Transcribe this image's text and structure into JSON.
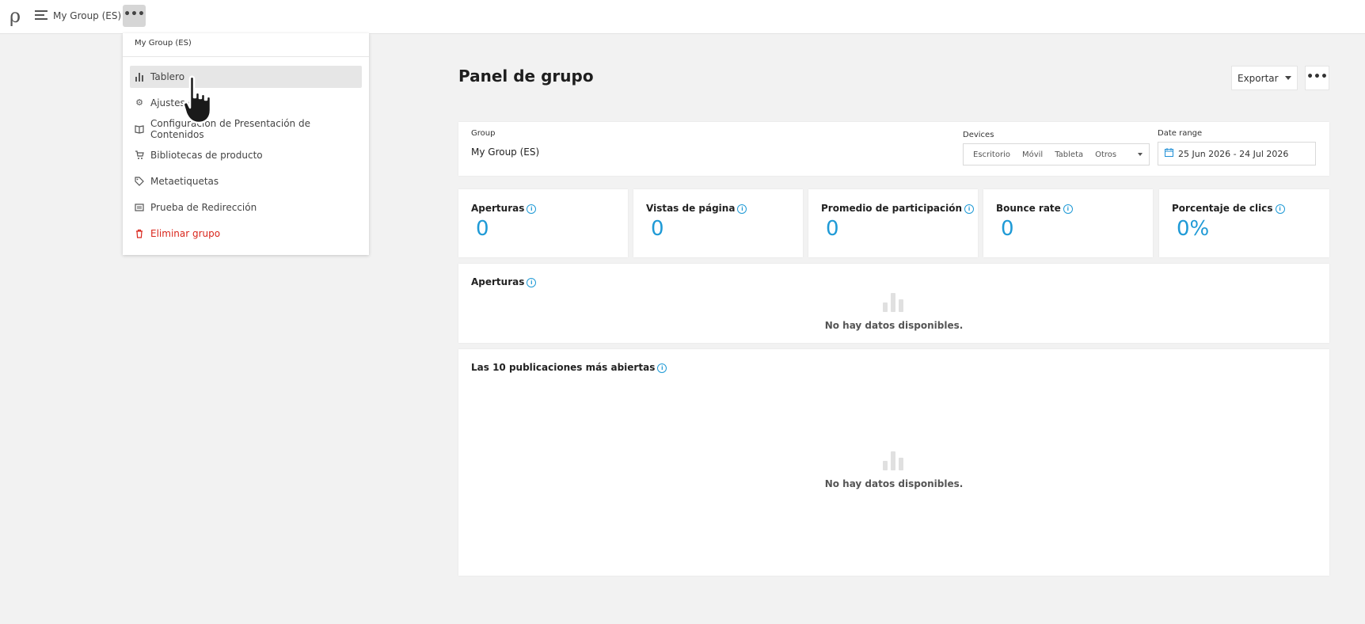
{
  "topbar": {
    "logo": "ρ",
    "title": "My Group (ES)",
    "more_glyph": "•••"
  },
  "dropdown": {
    "header": "My Group (ES)",
    "items": [
      {
        "label": "Tablero",
        "icon": "bar-chart-icon",
        "glyph": "▮"
      },
      {
        "label": "Ajustes d",
        "icon": "gear-icon",
        "glyph": "⚙"
      },
      {
        "label": "Configuración de Presentación de Contenidos",
        "icon": "book-icon",
        "glyph": "❐"
      },
      {
        "label": "Bibliotecas de producto",
        "icon": "cart-icon",
        "glyph": "⛟"
      },
      {
        "label": "Metaetiquetas",
        "icon": "tag-icon",
        "glyph": "⌂"
      },
      {
        "label": "Prueba de Redirección",
        "icon": "redirect-icon",
        "glyph": "▣"
      },
      {
        "label": "Eliminar grupo",
        "icon": "trash-icon",
        "glyph": "🗑"
      }
    ]
  },
  "main": {
    "title": "Panel de grupo",
    "export_label": "Exportar",
    "kebab_glyph": "•••"
  },
  "filters": {
    "group_label": "Group",
    "group_value": "My Group (ES)",
    "devices_label": "Devices",
    "devices": [
      "Escritorio",
      "Móvil",
      "Tableta",
      "Otros"
    ],
    "date_label": "Date range",
    "date_value": "25 Jun 2026 - 24 Jul 2026"
  },
  "metrics": [
    {
      "label": "Aperturas",
      "value": "0"
    },
    {
      "label": "Vistas de página",
      "value": "0"
    },
    {
      "label": "Promedio de participación",
      "value": "0"
    },
    {
      "label": "Bounce rate",
      "value": "0"
    },
    {
      "label": "Porcentaje de clics",
      "value": "0%"
    }
  ],
  "sections": {
    "opens_title": "Aperturas",
    "top10_title": "Las 10 publicaciones más abiertas",
    "empty_text": "No hay datos disponibles."
  },
  "colors": {
    "accent": "#1f9ad6",
    "danger": "#d9261c",
    "background": "#f2f2f2"
  }
}
